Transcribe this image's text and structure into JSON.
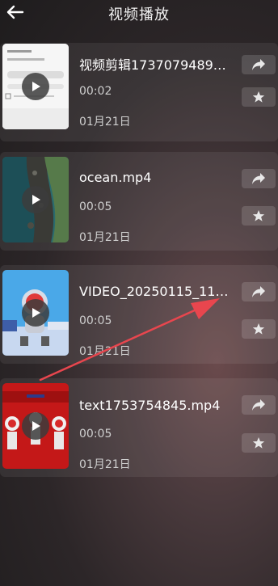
{
  "header": {
    "title": "视频播放"
  },
  "videos": [
    {
      "name": "视频剪辑1737079489…",
      "duration": "00:02",
      "date": "01月21日"
    },
    {
      "name": "ocean.mp4",
      "duration": "00:05",
      "date": "01月21日"
    },
    {
      "name": "VIDEO_20250115_115…",
      "duration": "00:05",
      "date": "01月21日"
    },
    {
      "name": "text1753754845.mp4",
      "duration": "00:05",
      "date": "01月21日"
    }
  ],
  "icons": {
    "back": "arrow-left-icon",
    "play": "play-icon",
    "share": "share-icon",
    "star": "star-icon"
  },
  "colors": {
    "annotation_arrow": "#e8464e",
    "accent": "#ffffff"
  }
}
